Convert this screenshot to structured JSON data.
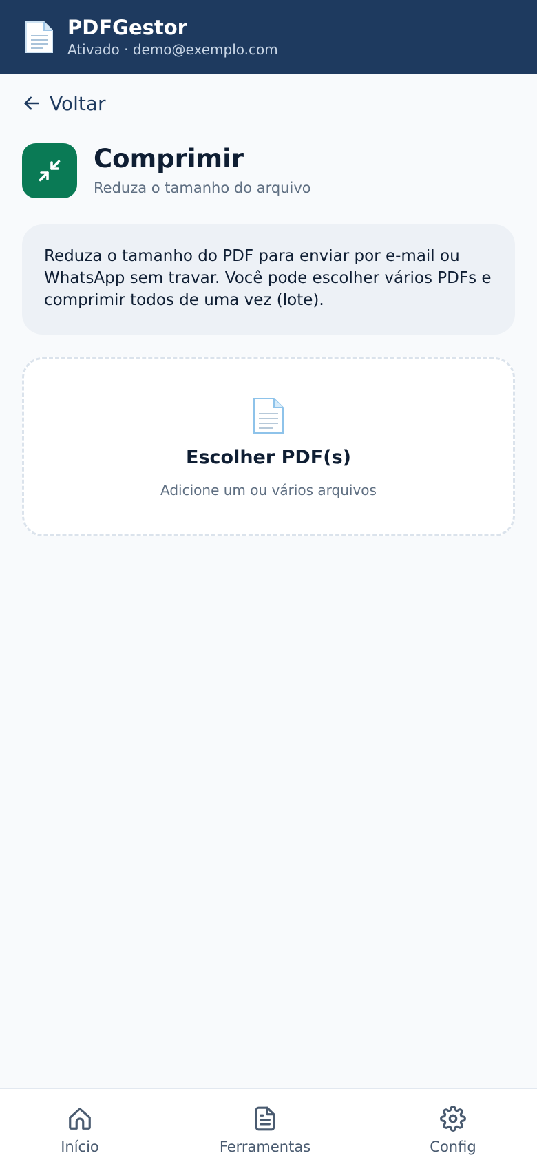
{
  "header": {
    "title": "PDFGestor",
    "status": "Ativado · demo@exemplo.com"
  },
  "back": {
    "label": "Voltar"
  },
  "tool": {
    "title": "Comprimir",
    "subtitle": "Reduza o tamanho do arquivo",
    "icon": "compress-icon",
    "color": "#0a7a55"
  },
  "info": {
    "text": "Reduza o tamanho do PDF para enviar por e-mail ou WhatsApp sem travar. Você pode escolher vários PDFs e comprimir todos de uma vez (lote)."
  },
  "dropzone": {
    "title": "Escolher PDF(s)",
    "subtitle": "Adicione um ou vários arquivos"
  },
  "nav": {
    "items": [
      {
        "label": "Início",
        "icon": "home-icon"
      },
      {
        "label": "Ferramentas",
        "icon": "document-icon"
      },
      {
        "label": "Config",
        "icon": "gear-icon"
      }
    ]
  },
  "colors": {
    "header_bg": "#1e3a5f",
    "accent": "#0a7a55",
    "page_bg": "#f8fafc"
  }
}
